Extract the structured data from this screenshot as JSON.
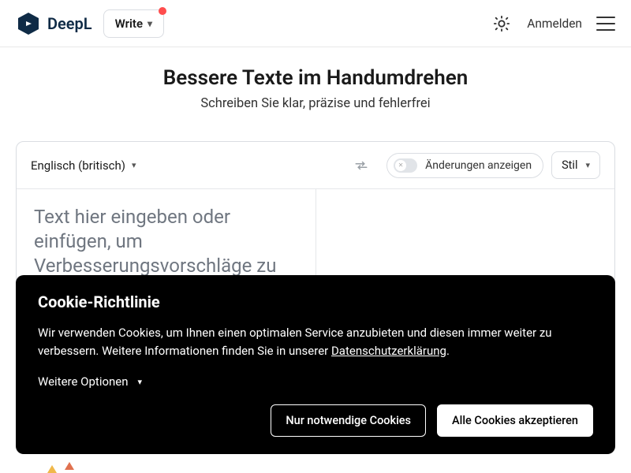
{
  "header": {
    "brand": "DeepL",
    "write_label": "Write",
    "signin_label": "Anmelden"
  },
  "hero": {
    "title": "Bessere Texte im Handumdrehen",
    "subtitle": "Schreiben Sie klar, präzise und fehlerfrei"
  },
  "toolbar": {
    "language": "Englisch (britisch)",
    "toggle_label": "Änderungen anzeigen",
    "style_label": "Stil"
  },
  "editor": {
    "placeholder": "Text hier eingeben oder einfügen, um Verbesserungsvorschläge zu sehen"
  },
  "cookie": {
    "title": "Cookie-Richtlinie",
    "text_before_link": "Wir verwenden Cookies, um Ihnen einen optimalen Service anzubieten und diesen immer weiter zu verbessern. Weitere Informationen finden Sie in unserer ",
    "privacy_link": "Datenschutzerklärung",
    "text_after_link": ".",
    "more_options": "Weitere Optionen",
    "btn_necessary": "Nur notwendige Cookies",
    "btn_accept": "Alle Cookies akzeptieren"
  }
}
